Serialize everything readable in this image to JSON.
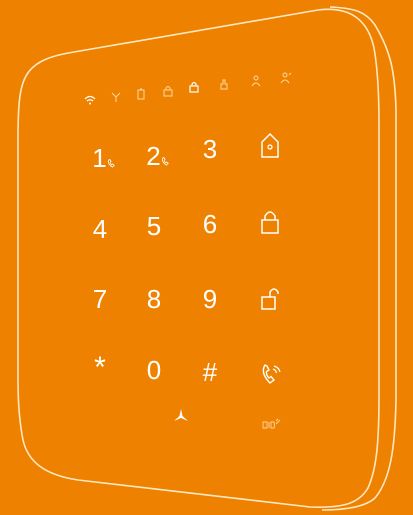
{
  "keypad": {
    "keys": [
      "1",
      "2",
      "3",
      "4",
      "5",
      "6",
      "7",
      "8",
      "9",
      "*",
      "0",
      "#"
    ]
  },
  "icons": {
    "status": [
      "wifi-icon",
      "signal-icon",
      "battery-icon",
      "lock-icon",
      "lock-icon",
      "hand-icon",
      "person-icon",
      "person-icon"
    ],
    "function_keys": [
      "home-arm-icon",
      "arm-lock-icon",
      "disarm-unlock-icon",
      "phone-call-icon"
    ],
    "bottom": [
      "fan-logo-icon",
      "rfid-icon"
    ]
  },
  "colors": {
    "background": "#ee8200",
    "icon": "#ffffff"
  }
}
